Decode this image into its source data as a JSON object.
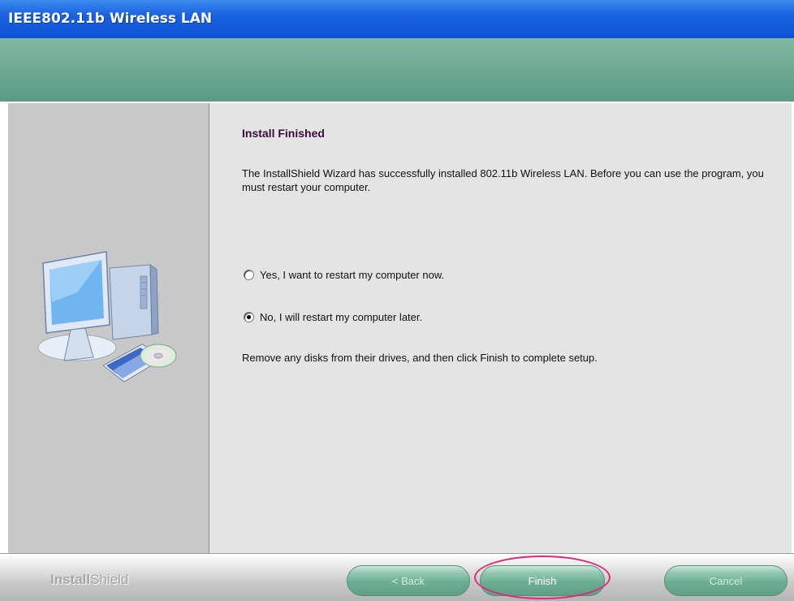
{
  "window": {
    "title": "IEEE802.11b Wireless LAN"
  },
  "content": {
    "heading": "Install Finished",
    "description": "The InstallShield Wizard has successfully installed 802.11b Wireless LAN.  Before you can use the program, you must restart your computer.",
    "options": [
      {
        "label": "Yes, I want to restart my computer now.",
        "checked": false
      },
      {
        "label": "No, I will restart my computer later.",
        "checked": true
      }
    ],
    "remove_note": "Remove any disks from their drives, and then click Finish to complete setup."
  },
  "footer": {
    "brand_bold": "Install",
    "brand_light": "Shield",
    "back_label": "< Back",
    "finish_label": "Finish",
    "cancel_label": "Cancel"
  },
  "colors": {
    "titlebar": "#1a62e0",
    "banner": "#6ba892",
    "button": "#6eae95",
    "highlight_ring": "#e0287a"
  },
  "icons": {
    "illustration": "computer-with-cd-icon"
  }
}
